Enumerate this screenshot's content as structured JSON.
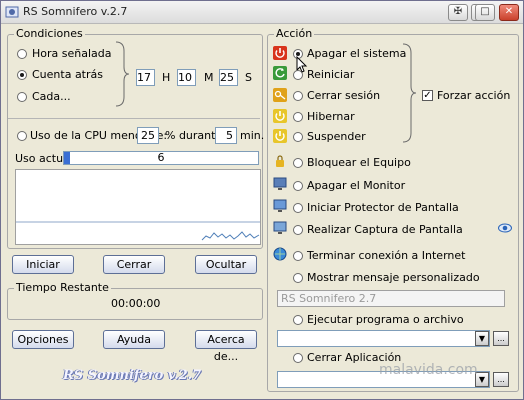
{
  "window": {
    "title": "RS Somnifero v.2.7"
  },
  "conditions": {
    "title": "Condiciones",
    "options": [
      "Hora señalada",
      "Cuenta atrás",
      "Cada..."
    ],
    "selected_index": 1,
    "hours": "17",
    "hours_label": "H",
    "minutes": "10",
    "minutes_label": "M",
    "seconds": "25",
    "seconds_label": "S",
    "cpu_label": "Uso de la CPU menor de:",
    "cpu_value": "25",
    "during_label": "% durante",
    "during_value": "5",
    "min_label": "min.",
    "usage_label": "Uso actual:",
    "usage_value": "6",
    "usage_fraction": 0.03
  },
  "buttons": {
    "start": "Iniciar",
    "close": "Cerrar",
    "hide": "Ocultar",
    "options": "Opciones",
    "help": "Ayuda",
    "about": "Acerca de..."
  },
  "remaining": {
    "title": "Tiempo Restante",
    "value": "00:00:00"
  },
  "action": {
    "title": "Acción",
    "power_options": [
      "Apagar el sistema",
      "Reiniciar",
      "Cerrar sesión",
      "Hibernar",
      "Suspender"
    ],
    "selected_index": 0,
    "force_label": "Forzar acción",
    "force_checked": true,
    "other_options": [
      "Bloquear el Equipo",
      "Apagar el Monitor",
      "Iniciar Protector de Pantalla",
      "Realizar Captura de Pantalla",
      "Terminar conexión a Internet",
      "Mostrar mensaje personalizado"
    ],
    "message_value": "RS Somnifero 2.7",
    "run_label": "Ejecutar programa o archivo",
    "close_app_label": "Cerrar Aplicación",
    "browse": "..."
  },
  "footer": {
    "logo_text": "RS Somnifero v.2.7",
    "site": "malavida.com"
  },
  "colors": {
    "title_bar": "#dcdcdc",
    "face": "#ece9d8",
    "field_border": "#7f9db9",
    "accent_close": "#c9412b"
  }
}
